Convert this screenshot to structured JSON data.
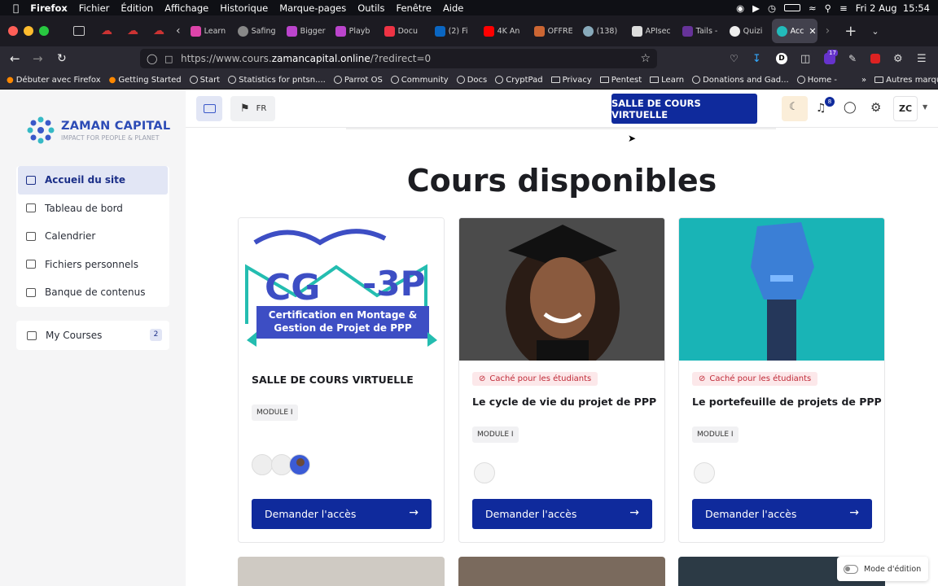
{
  "menubar": {
    "app": "Firefox",
    "items": [
      "Fichier",
      "Édition",
      "Affichage",
      "Historique",
      "Marque-pages",
      "Outils",
      "Fenêtre",
      "Aide"
    ],
    "datetime": "Fri 2 Aug  15:54"
  },
  "tabs": [
    "Learn",
    "Safing",
    "Bigger",
    "Playb",
    "Docu",
    "(2) Fi",
    "4K An",
    "OFFRE",
    "(138)",
    "APIsec",
    "Tails -",
    "Quizi",
    "Acc"
  ],
  "url": {
    "prefix": "https://www.cours.",
    "domain": "zamancapital.online",
    "suffix": "/?redirect=0"
  },
  "bookmarks": [
    "Débuter avec Firefox",
    "Getting Started",
    "Start",
    "Statistics for pntsn....",
    "Parrot OS",
    "Community",
    "Docs",
    "CryptPad",
    "Privacy",
    "Pentest",
    "Learn",
    "Donations and Gad...",
    "Home -",
    "Autres marque-pages"
  ],
  "ext_badge": "17",
  "logo": {
    "name": "ZAMAN CAPITAL",
    "tagline": "IMPACT FOR PEOPLE & PLANET"
  },
  "nav": [
    "Accueil du site",
    "Tableau de bord",
    "Calendrier",
    "Fichiers personnels",
    "Banque de contenus"
  ],
  "mycourses": {
    "label": "My Courses",
    "count": "2"
  },
  "topbar": {
    "lang": "FR",
    "salle": "SALLE DE COURS VIRTUELLE",
    "notif_count": "8",
    "user": "ZC"
  },
  "heading": "Cours disponibles",
  "cards": [
    {
      "title": "SALLE DE COURS VIRTUELLE",
      "module": "MODULE I",
      "badge": "",
      "cta": "Demander l'accès",
      "img_logo": "CG-3P",
      "img_line1": "Certification en Montage &",
      "img_line2": "Gestion de Projet de PPP"
    },
    {
      "title": "Le cycle de vie du projet de PPP",
      "module": "MODULE I",
      "badge": "Caché pour les étudiants",
      "cta": "Demander l'accès"
    },
    {
      "title": "Le portefeuille de projets de PPP",
      "module": "MODULE I",
      "badge": "Caché pour les étudiants",
      "cta": "Demander l'accès"
    }
  ],
  "edit_mode": "Mode d'édition"
}
